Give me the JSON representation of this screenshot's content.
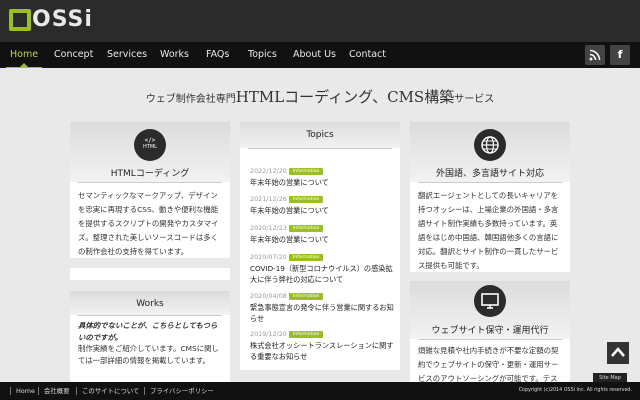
{
  "brand": {
    "logo_text": "OSSi"
  },
  "nav": {
    "items": [
      "Home",
      "Concept",
      "Services",
      "Works",
      "FAQs",
      "Topics",
      "About Us",
      "Contact"
    ],
    "active": "Home"
  },
  "social": {
    "rss_icon": "rss-icon",
    "facebook_icon": "facebook-icon",
    "facebook_glyph": "f"
  },
  "headline": {
    "prefix": "ウェブ制作会社専門",
    "emphasis": "HTMLコーディング、CMS構築",
    "suffix": "サービス"
  },
  "cards": {
    "html": {
      "title": "HTMLコーディング",
      "icon_label": "HTML",
      "body": "セマンティックなマークアップ、デザインを忠実に再現するCSS、動きや便利な機能を提供するスクリプトの開発やカスタマイズ。整理された美しいソースコードは多くの制作会社の支持を得ています。"
    },
    "works": {
      "title": "Works",
      "lead": "具体的でないことが、こちらとしてもつらいのですが。",
      "body": "制作実績をご紹介しています。CMSに関しては一部詳細の情報を掲載しています。"
    },
    "topics": {
      "title": "Topics",
      "items": [
        {
          "date": "2022/12/20",
          "badge": "Information",
          "text": "年末年始の営業について"
        },
        {
          "date": "2021/12/26",
          "badge": "Information",
          "text": "年末年始の営業について"
        },
        {
          "date": "2020/12/23",
          "badge": "Information",
          "text": "年末年始の営業について"
        },
        {
          "date": "2020/07/20",
          "badge": "Information",
          "text": "COVID-19（新型コロナウイルス）の感染拡大に伴う弊社の対応について"
        },
        {
          "date": "2020/04/08",
          "badge": "Information",
          "text": "緊急事態宣言の発令に伴う営業に関するお知らせ"
        },
        {
          "date": "2019/12/20",
          "badge": "Information",
          "text": "株式会社オッシートランスレーションに関する重要なお知らせ"
        }
      ]
    },
    "language": {
      "title": "外国語、多言語サイト対応",
      "body": "翻訳エージェントとしての長いキャリアを持つオッシーは、上場企業の外国語・多言語サイト制作実績も多数持っています。英語をはじめ中国語、韓国語他多くの言語に対応。翻訳とサイト制作の一貫したサービス提供も可能です。"
    },
    "maintenance": {
      "title": "ウェブサイト保守・運用代行",
      "body": "煩雑な見積や社内手続きが不要な定額の契約でウェブサイトの保守・更新・運用サービスのアウトソーシングが可能です。テストサー"
    }
  },
  "footer": {
    "links": [
      "Home",
      "会社概要",
      "このサイトについて",
      "プライバシーポリシー"
    ],
    "copyright": "Copyright (c)2014 OSSi Inc. All rights reserved.",
    "sitemap": "Site Map"
  }
}
